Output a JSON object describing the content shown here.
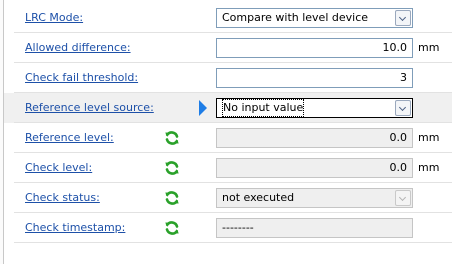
{
  "rows": [
    {
      "label": "LRC Mode:",
      "value": "Compare with level device",
      "unit": ""
    },
    {
      "label": "Allowed difference:",
      "value": "10.0",
      "unit": "mm"
    },
    {
      "label": "Check fail threshold:",
      "value": "3",
      "unit": ""
    },
    {
      "label": "Reference level source:",
      "value": "No input value",
      "unit": ""
    },
    {
      "label": "Reference level:",
      "value": "0.0",
      "unit": "mm",
      "icon": "refresh-icon"
    },
    {
      "label": "Check level:",
      "value": "0.0",
      "unit": "mm",
      "icon": "refresh-icon"
    },
    {
      "label": "Check status:",
      "value": "not executed",
      "unit": "",
      "icon": "refresh-icon"
    },
    {
      "label": "Check timestamp:",
      "value": "--------",
      "unit": "",
      "icon": "refresh-icon"
    }
  ],
  "colors": {
    "label_link": "#1d50a8",
    "refresh_icon": "#2aa12a",
    "pointer_arrow": "#1e7de6"
  }
}
